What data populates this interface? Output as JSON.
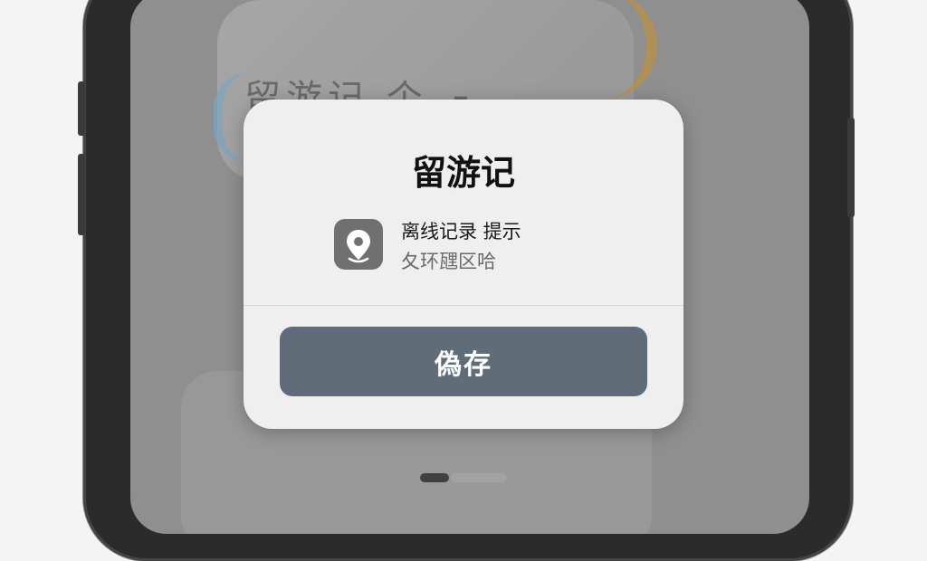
{
  "background": {
    "app_title_partial": "留游记 个 ┌"
  },
  "dialog": {
    "title": "留游记",
    "app_icon": "location-pin-icon",
    "message_line1": "离线记录 提示",
    "message_line2": "夂环瓼区哈",
    "save_button_label": "偽存"
  },
  "pager": {
    "current_page": 1,
    "total_pages": 2
  },
  "colors": {
    "button": "#606c78",
    "dialog_bg": "#efefef",
    "screen_dim": "#8f8f8f"
  }
}
